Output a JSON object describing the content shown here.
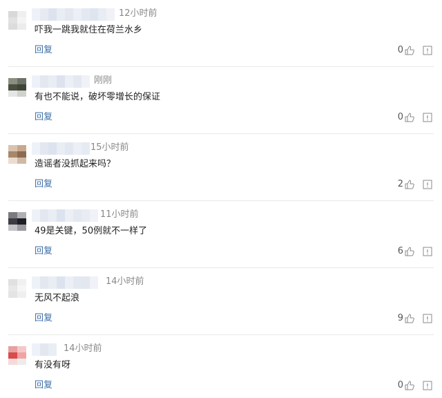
{
  "colors": {
    "reply": "#3b6da8",
    "time": "#888888",
    "divider": "#e8e8e8"
  },
  "comments": [
    {
      "time": "12小时前",
      "text": "吓我一跳我就住在荷兰水乡",
      "reply": "回复",
      "likes": "0",
      "avatar": [
        "#d8d8d8",
        "#efefef",
        "#e2e2e2",
        "#f4f4f4",
        "#dcdcdc",
        "#ececec"
      ]
    },
    {
      "time": "刚刚",
      "text": "有也不能说，破坏零增长的保证",
      "reply": "回复",
      "likes": "0",
      "avatar": [
        "#8a8f80",
        "#6c7268",
        "#4a5040",
        "#3f4536",
        "#e5e5e5",
        "#d0d2cc"
      ]
    },
    {
      "time": "15小时前",
      "text": "造谣者没抓起来吗？",
      "reply": "回复",
      "likes": "2",
      "avatar": [
        "#d9c2b0",
        "#c8a88c",
        "#a8876a",
        "#8c6a52",
        "#ecdcd0",
        "#d0b8a4"
      ]
    },
    {
      "time": "11小时前",
      "text": "49是关键，50例就不一样了",
      "reply": "回复",
      "likes": "6",
      "avatar": [
        "#7a7a80",
        "#b0b0b4",
        "#3c3c44",
        "#1e1e26",
        "#c4c4c8",
        "#9a9aa0"
      ]
    },
    {
      "time": "14小时前",
      "text": "无风不起浪",
      "reply": "回复",
      "likes": "9",
      "avatar": [
        "#e0e0e0",
        "#f0f0f0",
        "#e8e8e8",
        "#f6f6f6",
        "#e4e4e4",
        "#efefef"
      ]
    },
    {
      "time": "14小时前",
      "text": "有没有呀",
      "reply": "回复",
      "likes": "0",
      "avatar": [
        "#e8a0a0",
        "#f4c8c8",
        "#d84c4c",
        "#f0a4a4",
        "#f6dada",
        "#ececec"
      ]
    }
  ],
  "icons": {
    "like": "thumbs-up-icon",
    "report": "report-icon"
  }
}
